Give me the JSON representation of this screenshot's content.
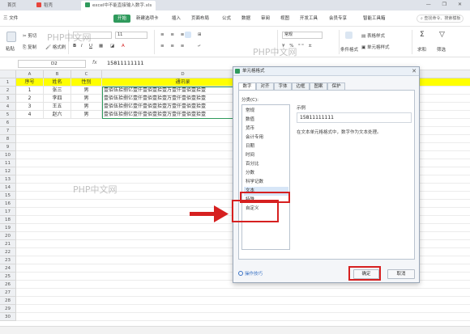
{
  "tabs": [
    {
      "label": "首页",
      "active": false
    },
    {
      "label": "稻壳",
      "active": false
    },
    {
      "label": "excel中不能直接输入数字.xls",
      "active": true
    }
  ],
  "menu": {
    "file": "三 文件",
    "items": [
      "开始",
      "插入",
      "页面布局",
      "公式",
      "数据",
      "审阅",
      "视图",
      "开发工具",
      "会员专享",
      "智能工具箱"
    ],
    "new_tab": "新建选项卡",
    "search": "查找命令、搜索模板"
  },
  "ribbon": {
    "paste": "粘贴",
    "cut": "剪切",
    "copy": "复制",
    "format_painter": "格式刷",
    "font_size": "11",
    "number_format": "常规",
    "conditional_format": "条件格式",
    "table_style": "表格样式",
    "cell_style": "单元格样式",
    "sum": "求和",
    "filter": "筛选"
  },
  "formula_bar": {
    "cell_ref": "D2",
    "fx": "fx",
    "value": "15811111111"
  },
  "sheet": {
    "columns": [
      "A",
      "B",
      "C",
      "D"
    ],
    "rows": [
      "1",
      "2",
      "3",
      "4",
      "5",
      "6",
      "7",
      "8",
      "9",
      "10",
      "11",
      "12",
      "13",
      "14",
      "15",
      "16",
      "17",
      "18",
      "19",
      "20",
      "21",
      "22",
      "23",
      "24",
      "25",
      "26",
      "27",
      "28",
      "29",
      "30"
    ],
    "header": [
      "序号",
      "姓名",
      "性别",
      "通讯录"
    ],
    "data": [
      [
        "1",
        "张三",
        "男",
        "壹佰伍拾捌亿壹仟壹佰壹拾壹万壹仟壹佰壹拾壹"
      ],
      [
        "2",
        "李四",
        "男",
        "壹佰伍拾捌亿壹仟壹佰壹拾壹万壹仟壹佰壹拾壹"
      ],
      [
        "3",
        "王五",
        "男",
        "壹佰伍拾捌亿壹仟壹佰壹拾壹万壹仟壹佰壹拾壹"
      ],
      [
        "4",
        "赵六",
        "男",
        "壹佰伍拾捌亿壹仟壹佰壹拾壹万壹仟壹佰壹拾壹"
      ]
    ]
  },
  "watermark": "PHP中文网",
  "dialog": {
    "title": "单元格格式",
    "tabs": [
      "数字",
      "对齐",
      "字体",
      "边框",
      "图案",
      "保护"
    ],
    "category_label": "分类(C):",
    "categories": [
      "常规",
      "数值",
      "货币",
      "会计专用",
      "日期",
      "时间",
      "百分比",
      "分数",
      "科学记数",
      "文本",
      "特殊",
      "自定义"
    ],
    "selected_category": "文本",
    "sample_label": "示例",
    "sample_value": "15811111111",
    "description": "在文本单元格格式中，数字作为文本处理。",
    "help_link": "操作技巧",
    "ok": "确定",
    "cancel": "取消"
  },
  "colors": {
    "accent_green": "#2f9a5c",
    "header_yellow": "#ffff00",
    "annotation_red": "#d62020"
  }
}
